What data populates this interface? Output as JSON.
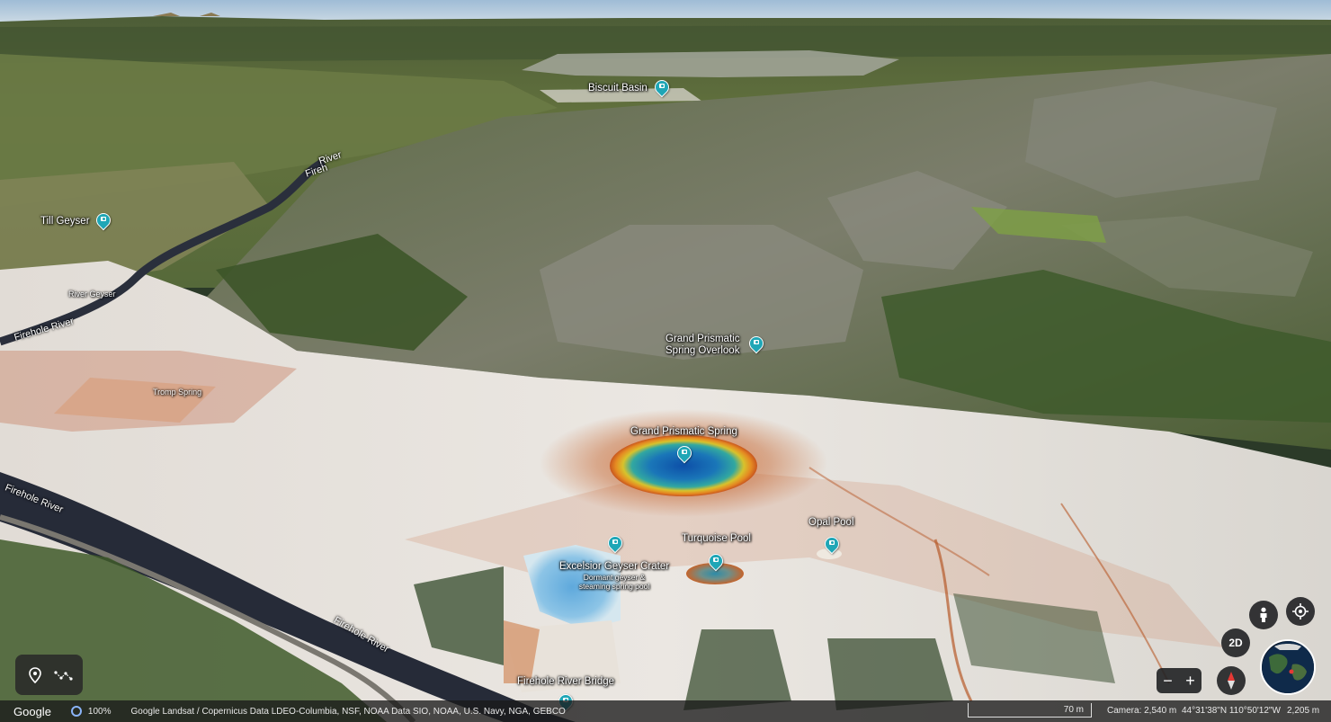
{
  "map": {
    "places": [
      {
        "id": "biscuit-basin",
        "label": "Biscuit Basin"
      },
      {
        "id": "till-geyser",
        "label": "Till Geyser"
      },
      {
        "id": "river-geyser",
        "label": "River Geyser"
      },
      {
        "id": "tromp-spring",
        "label": "Tromp Spring"
      },
      {
        "id": "grand-prismatic-overlook",
        "line1": "Grand Prismatic",
        "line2": "Spring Overlook"
      },
      {
        "id": "grand-prismatic-spring",
        "label": "Grand Prismatic Spring"
      },
      {
        "id": "turquoise-pool",
        "label": "Turquoise Pool"
      },
      {
        "id": "opal-pool",
        "label": "Opal Pool"
      },
      {
        "id": "excelsior",
        "label": "Excelsior Geyser Crater",
        "sub1": "Dormant geyser &",
        "sub2": "steaming spring pool"
      },
      {
        "id": "firehole-bridge",
        "label": "Firehole River Bridge"
      }
    ],
    "rivers": {
      "upper_a": "Fireh",
      "upper_b": "River",
      "left_mid": "Firehole River",
      "left_low": "Firehole River",
      "bottom": "Firehole River"
    }
  },
  "controls": {
    "view_2d": "2D",
    "zoom_out": "−",
    "zoom_in": "+"
  },
  "status": {
    "brand": "Google",
    "load_percent": "100%",
    "credits": "Google   Landsat / Copernicus   Data LDEO-Columbia, NSF, NOAA   Data SIO, NOAA, U.S. Navy, NGA, GEBCO",
    "scale": "70 m",
    "camera": "Camera: 2,540 m",
    "coordinates": "44°31'38\"N 110°50'12\"W",
    "elevation": "2,205 m"
  },
  "colors": {
    "pin": "#1fa6b6",
    "spring_center": "#1565c0",
    "spring_ring": "#e0a21a",
    "bacterial_mat": "#d2692a",
    "sinter": "#e9e6e1",
    "forest": "#3e5a2b",
    "river": "#2a2f3c"
  }
}
